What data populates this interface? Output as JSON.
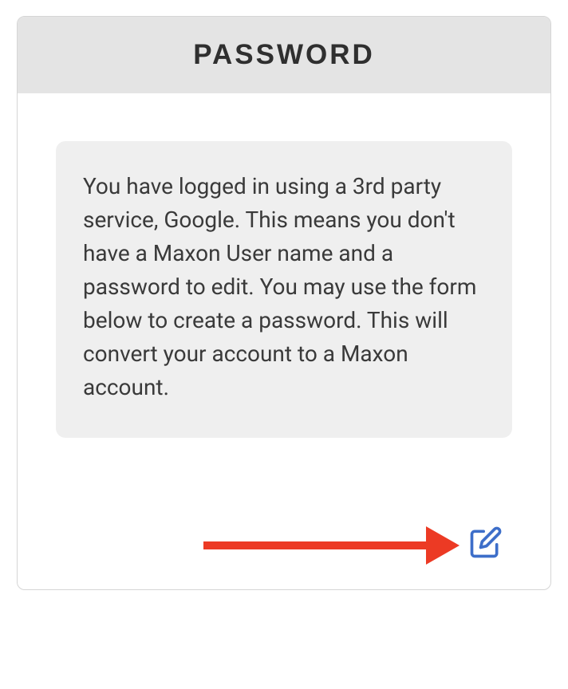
{
  "card": {
    "title": "PASSWORD",
    "info_text": "You have logged in using a 3rd party service, Google. This means you don't have a Maxon User name and a password to edit. You may use the form below to create a password. This will convert your account to a Maxon account."
  },
  "colors": {
    "accent": "#3d6ec9",
    "arrow": "#ec3a24"
  }
}
